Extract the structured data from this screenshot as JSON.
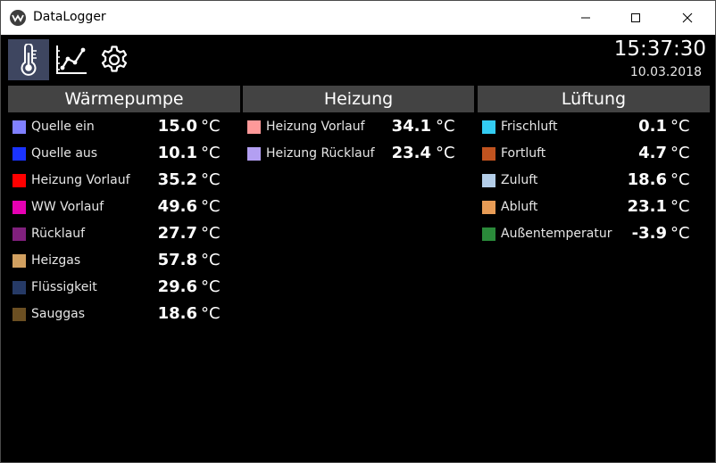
{
  "window": {
    "title": "DataLogger"
  },
  "clock": {
    "time": "15:37:30",
    "date": "10.03.2018"
  },
  "panels": [
    {
      "title": "Wärmepumpe",
      "rows": [
        {
          "label": "Quelle ein",
          "value": "15.0",
          "unit": "°C",
          "color": "#8080ff"
        },
        {
          "label": "Quelle aus",
          "value": "10.1",
          "unit": "°C",
          "color": "#1a33ff"
        },
        {
          "label": "Heizung Vorlauf",
          "value": "35.2",
          "unit": "°C",
          "color": "#ff0000"
        },
        {
          "label": "WW Vorlauf",
          "value": "49.6",
          "unit": "°C",
          "color": "#e600b3"
        },
        {
          "label": "Rücklauf",
          "value": "27.7",
          "unit": "°C",
          "color": "#80207d"
        },
        {
          "label": "Heizgas",
          "value": "57.8",
          "unit": "°C",
          "color": "#d1a060"
        },
        {
          "label": "Flüssigkeit",
          "value": "29.6",
          "unit": "°C",
          "color": "#263a66"
        },
        {
          "label": "Sauggas",
          "value": "18.6",
          "unit": "°C",
          "color": "#6b4f22"
        }
      ]
    },
    {
      "title": "Heizung",
      "rows": [
        {
          "label": "Heizung Vorlauf",
          "value": "34.1",
          "unit": "°C",
          "color": "#ff9999"
        },
        {
          "label": "Heizung Rücklauf",
          "value": "23.4",
          "unit": "°C",
          "color": "#b39ff2"
        }
      ]
    },
    {
      "title": "Lüftung",
      "rows": [
        {
          "label": "Frischluft",
          "value": "0.1",
          "unit": "°C",
          "color": "#33ccf2"
        },
        {
          "label": "Fortluft",
          "value": "4.7",
          "unit": "°C",
          "color": "#c0531f"
        },
        {
          "label": "Zuluft",
          "value": "18.6",
          "unit": "°C",
          "color": "#b3cde8"
        },
        {
          "label": "Abluft",
          "value": "23.1",
          "unit": "°C",
          "color": "#e89c56"
        },
        {
          "label": "Außentemperatur",
          "value": "-3.9",
          "unit": "°C",
          "color": "#2a8a3a"
        }
      ]
    }
  ],
  "toolbar": {
    "active": "thermometer-icon"
  }
}
